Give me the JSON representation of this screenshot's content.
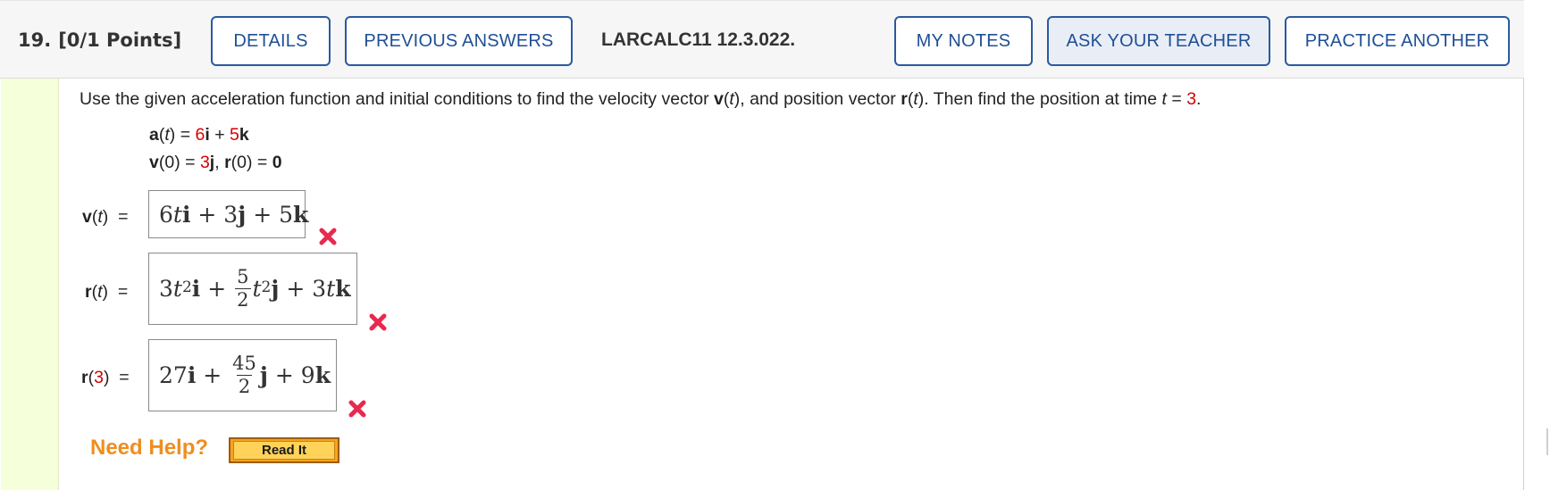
{
  "header": {
    "question_number": "19.",
    "points": "[0/1 Points]",
    "details_label": "DETAILS",
    "previous_answers_label": "PREVIOUS ANSWERS",
    "problem_code": "LARCALC11 12.3.022.",
    "my_notes_label": "MY NOTES",
    "ask_teacher_label": "ASK YOUR TEACHER",
    "practice_another_label": "PRACTICE ANOTHER"
  },
  "prompt": {
    "part1": "Use the given acceleration function and initial conditions to find the velocity vector ",
    "v": "v",
    "t1": "t",
    "part2": "), and position vector ",
    "r": "r",
    "t2": "t",
    "part3": "). Then find the position at time ",
    "t3": "t",
    "eq": " = ",
    "time_value": "3",
    "end": "."
  },
  "given": {
    "a_label": "a",
    "a_t": "t",
    "a_coef_i": "6",
    "a_i": "i",
    "a_coef_k": "5",
    "a_k": "k",
    "v0_label": "v",
    "v0_arg": "0",
    "v0_coef_j": "3",
    "v0_j": "j",
    "r0_label": "r",
    "r0_arg": "0",
    "r0_value": "0"
  },
  "answers": {
    "velocity_label_var": "v",
    "velocity_label_t": "t",
    "position_label_var": "r",
    "position_label_t": "t",
    "position3_label_var": "r",
    "position3_label_arg": "3",
    "velocity": {
      "c1": "6",
      "t": "t",
      "i": "i",
      "plus1": " + ",
      "c2": "3",
      "j": "j",
      "plus2": " + ",
      "c3": "5",
      "k": "k"
    },
    "position": {
      "c1": "3",
      "t1": "t",
      "exp1": "2",
      "i": "i",
      "plus1": " + ",
      "frac_num": "5",
      "frac_den": "2",
      "t2": "t",
      "exp2": "2",
      "j": "j",
      "plus2": " + ",
      "c3": "3",
      "t3": "t",
      "k": "k"
    },
    "position3": {
      "c1": "27",
      "i": "i",
      "plus1": " + ",
      "frac_num": "45",
      "frac_den": "2",
      "j": "j",
      "plus2": " + ",
      "c3": "9",
      "k": "k"
    }
  },
  "help": {
    "need_help": "Need Help?",
    "read_it": "Read It"
  },
  "colors": {
    "button_border": "#2a5aa0",
    "button_text": "#1f4f96",
    "incorrect_x": "#e8294f",
    "given_value_red": "#d40000",
    "gutter": "#f5ffd9",
    "need_help": "#f08d1f"
  },
  "icons": {
    "incorrect": "incorrect-x-icon"
  }
}
